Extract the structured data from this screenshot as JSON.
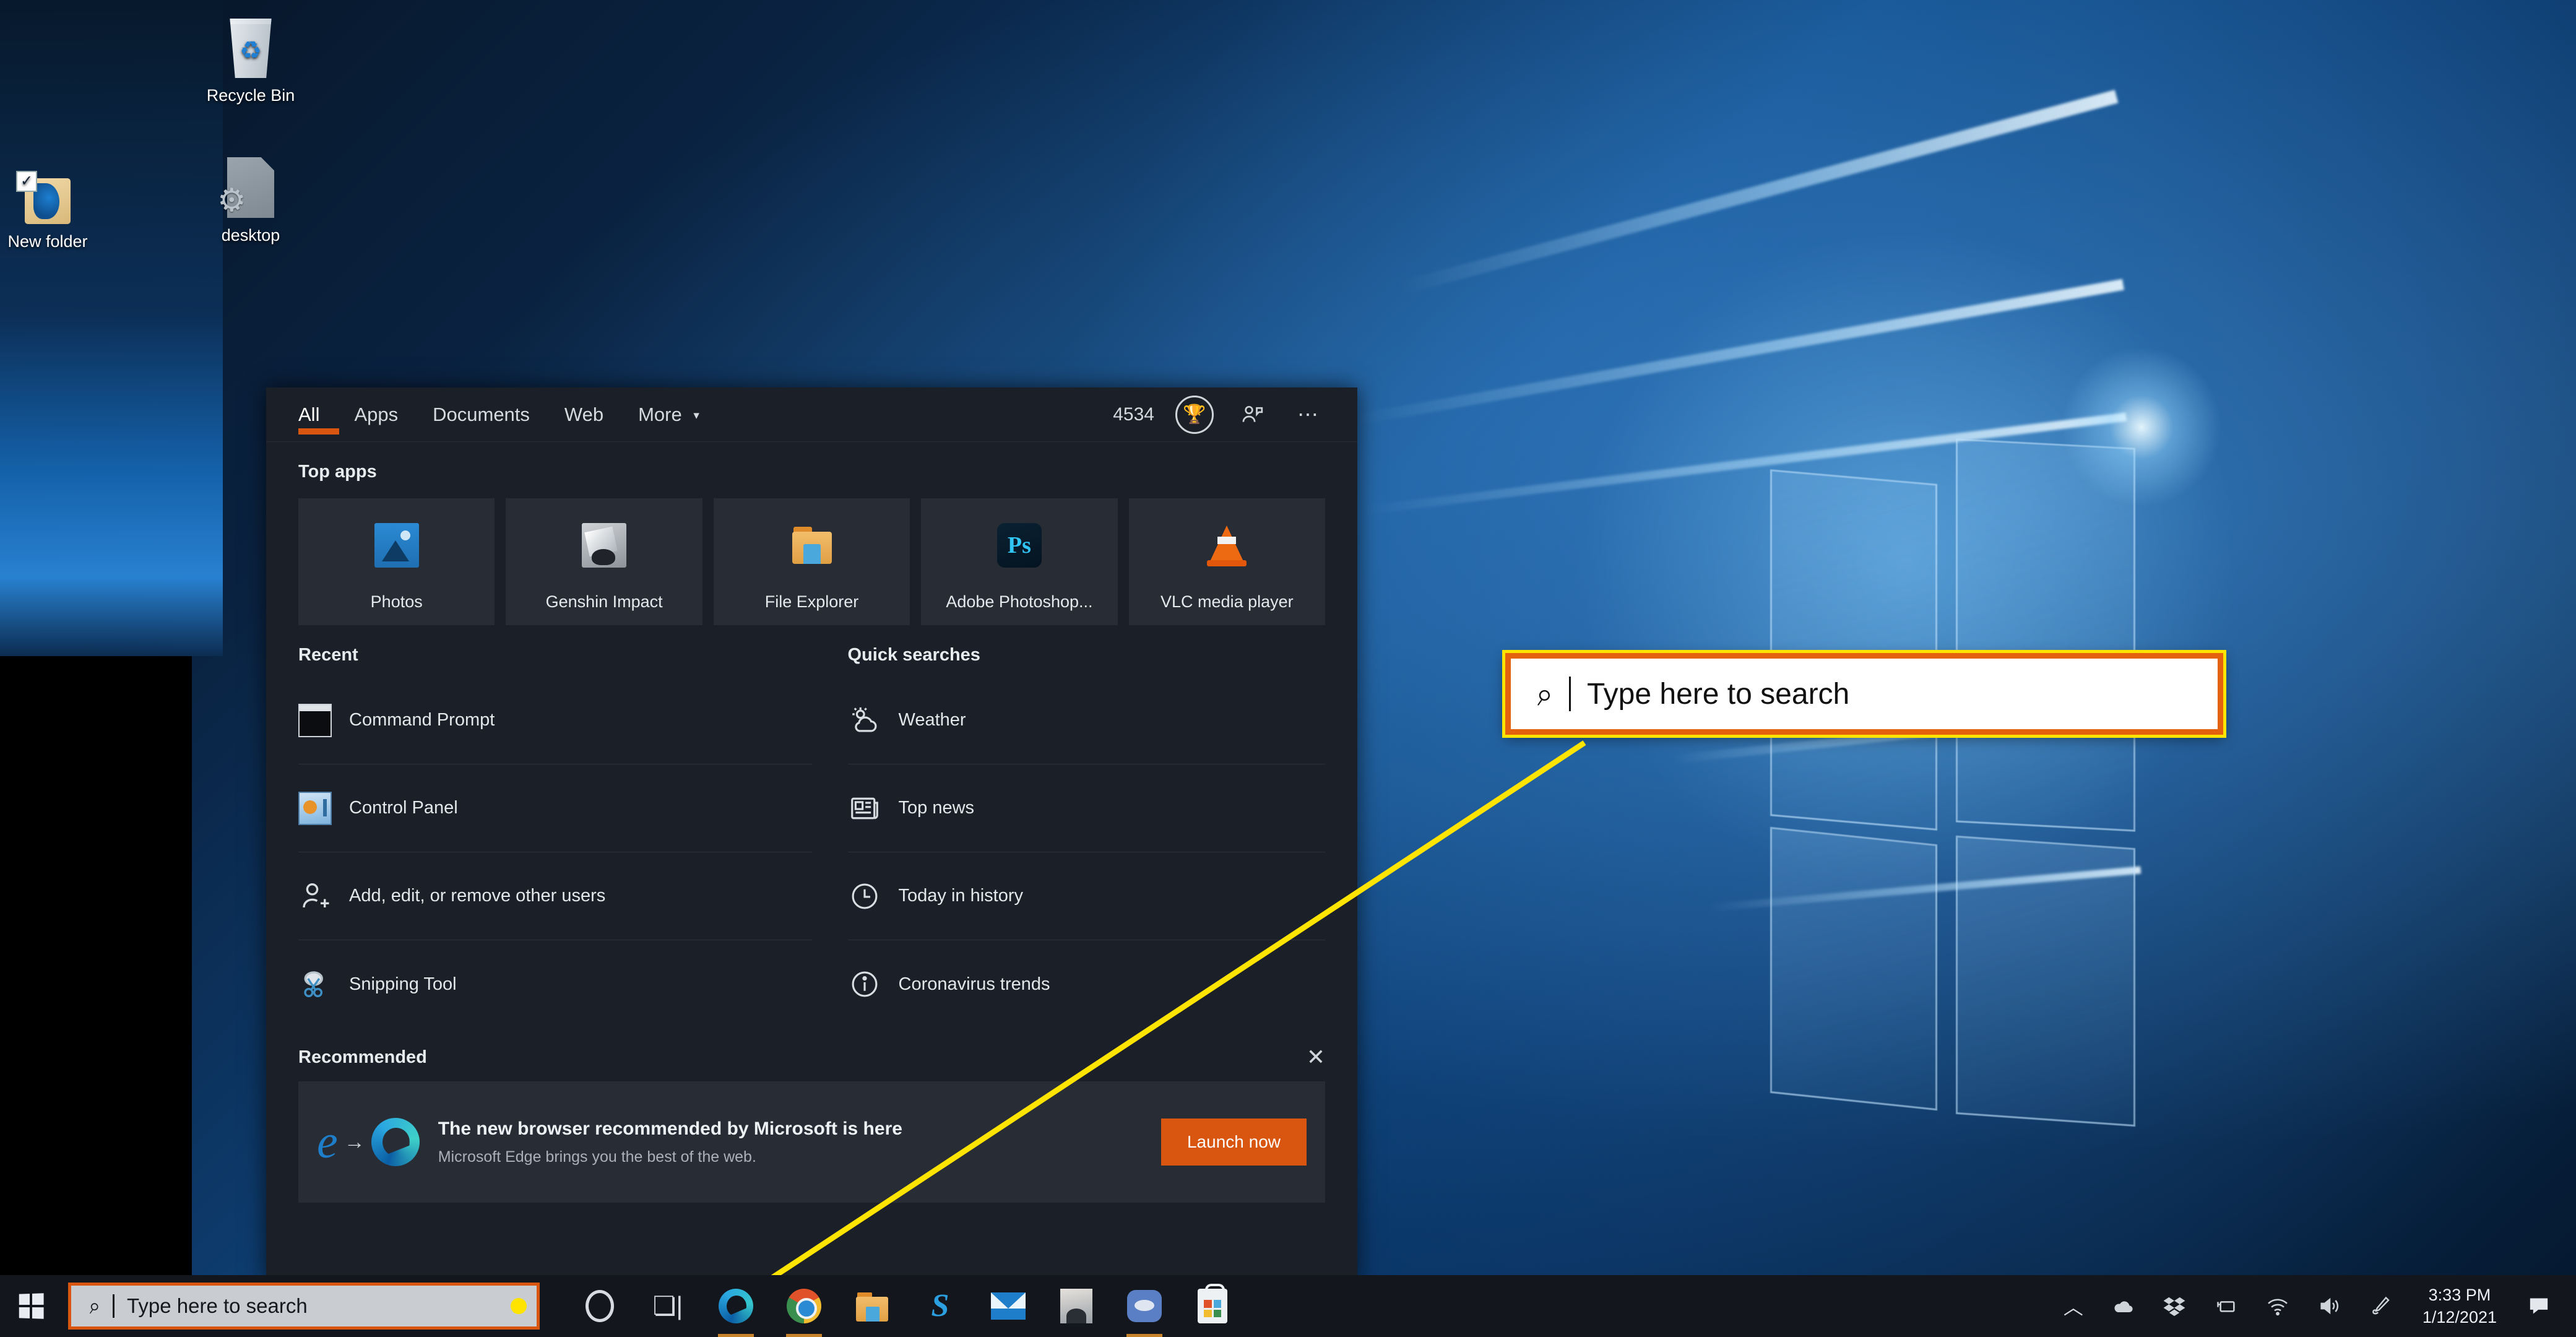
{
  "desktop": {
    "icons": [
      {
        "label": "Recycle Bin",
        "icon": "recycle-bin-icon"
      },
      {
        "label": "desktop",
        "icon": "config-file-icon"
      },
      {
        "label": "New folder",
        "icon": "folder-icon"
      }
    ]
  },
  "search_panel": {
    "tabs": [
      {
        "label": "All",
        "active": true
      },
      {
        "label": "Apps",
        "active": false
      },
      {
        "label": "Documents",
        "active": false
      },
      {
        "label": "Web",
        "active": false
      },
      {
        "label": "More",
        "active": false,
        "caret": "▾"
      }
    ],
    "rewards_count": "4534",
    "trophy_icon": "trophy-icon",
    "account_icon": "account-icon",
    "more_options_icon": "ellipsis-icon",
    "top_apps": {
      "title": "Top apps",
      "items": [
        {
          "label": "Photos",
          "icon": "photos-icon"
        },
        {
          "label": "Genshin Impact",
          "icon": "genshin-impact-icon"
        },
        {
          "label": "File Explorer",
          "icon": "file-explorer-icon"
        },
        {
          "label": "Adobe Photoshop...",
          "icon": "photoshop-icon"
        },
        {
          "label": "VLC media player",
          "icon": "vlc-icon"
        }
      ]
    },
    "recent": {
      "title": "Recent",
      "items": [
        {
          "label": "Command Prompt",
          "icon": "command-prompt-icon"
        },
        {
          "label": "Control Panel",
          "icon": "control-panel-icon"
        },
        {
          "label": "Add, edit, or remove other users",
          "icon": "add-user-icon"
        },
        {
          "label": "Snipping Tool",
          "icon": "snipping-tool-icon"
        }
      ]
    },
    "quick_searches": {
      "title": "Quick searches",
      "items": [
        {
          "label": "Weather",
          "icon": "weather-icon"
        },
        {
          "label": "Top news",
          "icon": "news-icon"
        },
        {
          "label": "Today in history",
          "icon": "clock-icon"
        },
        {
          "label": "Coronavirus trends",
          "icon": "info-icon"
        }
      ]
    },
    "recommended": {
      "title": "Recommended",
      "close_icon": "close-icon",
      "headline": "The new browser recommended by Microsoft is here",
      "subtext": "Microsoft Edge brings you the best of the web.",
      "button_label": "Launch now"
    }
  },
  "callout": {
    "placeholder": "Type here to search",
    "search_icon": "search-icon",
    "border_color": "#e4620e",
    "outline_color": "#ffe400"
  },
  "taskbar": {
    "start_icon": "windows-start-icon",
    "search": {
      "placeholder": "Type here to search",
      "search_icon": "search-icon",
      "highlight_color": "#d8560f"
    },
    "items": [
      {
        "icon": "cortana-icon",
        "running": false
      },
      {
        "icon": "task-view-icon",
        "running": false
      },
      {
        "icon": "microsoft-edge-icon",
        "running": true
      },
      {
        "icon": "google-chrome-icon",
        "running": true
      },
      {
        "icon": "file-explorer-icon",
        "running": false
      },
      {
        "icon": "snagit-icon",
        "running": false
      },
      {
        "icon": "mail-icon",
        "running": false
      },
      {
        "icon": "anime-app-icon",
        "running": false
      },
      {
        "icon": "discord-icon",
        "running": true
      },
      {
        "icon": "microsoft-store-icon",
        "running": false
      }
    ],
    "tray": {
      "show_hidden_icon": "chevron-up-icon",
      "icons": [
        {
          "icon": "onedrive-icon"
        },
        {
          "icon": "dropbox-icon"
        },
        {
          "icon": "battery-icon"
        },
        {
          "icon": "wifi-icon"
        },
        {
          "icon": "volume-icon"
        },
        {
          "icon": "pen-icon"
        }
      ],
      "time": "3:33 PM",
      "date": "1/12/2021",
      "action_center_icon": "action-center-icon"
    }
  }
}
